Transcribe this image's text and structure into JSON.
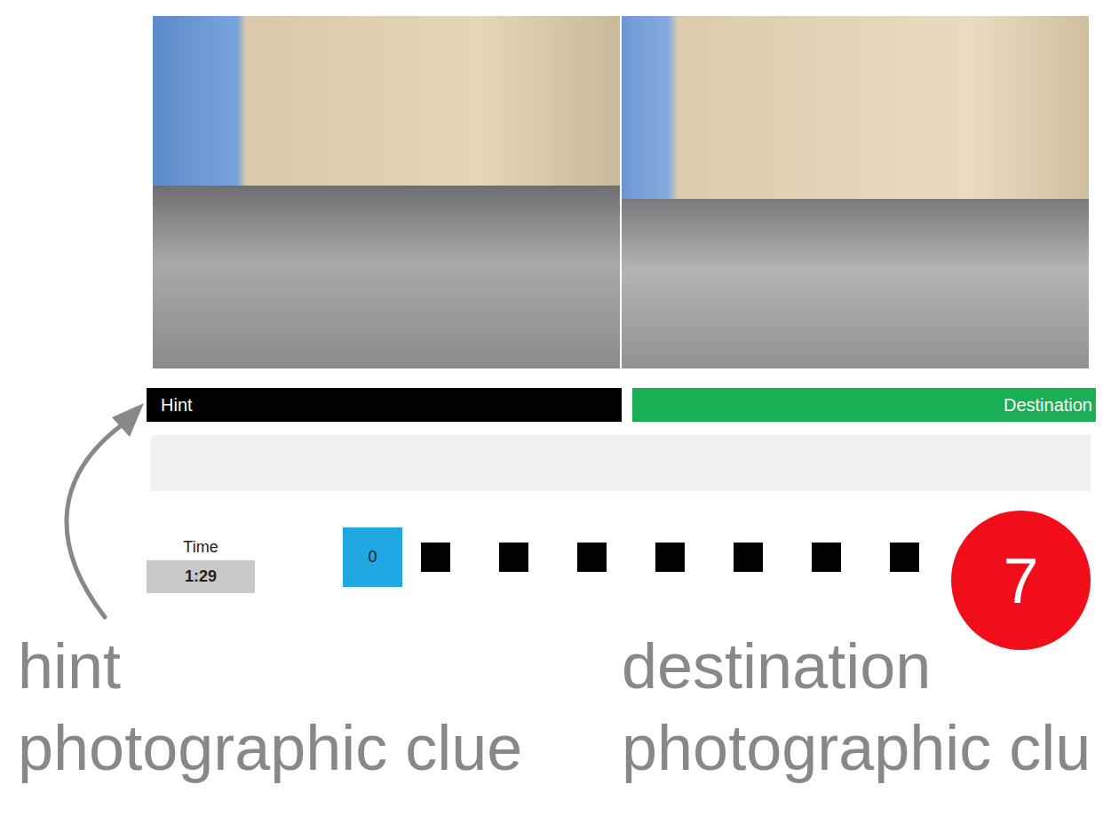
{
  "panels": [
    {
      "label": "Hint",
      "kind": "hint",
      "color": "#000000"
    },
    {
      "label": "Destination",
      "kind": "destination",
      "color": "#1aaf54"
    }
  ],
  "timer": {
    "label": "Time",
    "value": "1:29"
  },
  "steps": [
    {
      "label": "0",
      "selected": true
    },
    {
      "selected": false
    },
    {
      "selected": false
    },
    {
      "selected": false
    },
    {
      "selected": false
    },
    {
      "selected": false
    },
    {
      "selected": false
    },
    {
      "selected": false
    }
  ],
  "goal": {
    "label": "7"
  },
  "annotations": [
    {
      "lines": [
        "hint",
        "photographic clue"
      ]
    },
    {
      "lines": [
        "destination",
        "photographic clu"
      ]
    }
  ]
}
